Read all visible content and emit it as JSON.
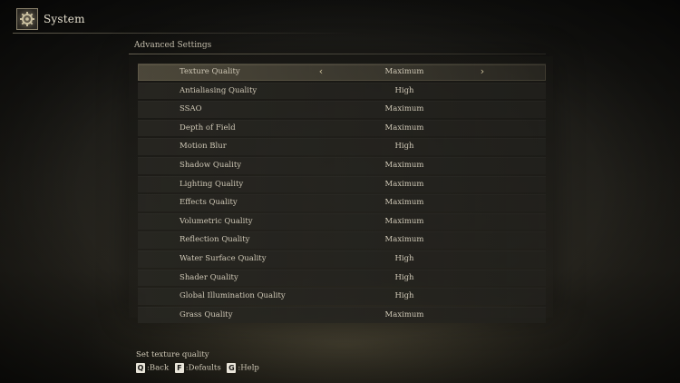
{
  "header": {
    "title": "System",
    "icon": "gear-icon"
  },
  "section": {
    "title": "Advanced Settings"
  },
  "settings": [
    {
      "label": "Texture Quality",
      "value": "Maximum",
      "selected": true
    },
    {
      "label": "Antialiasing Quality",
      "value": "High"
    },
    {
      "label": "SSAO",
      "value": "Maximum"
    },
    {
      "label": "Depth of Field",
      "value": "Maximum"
    },
    {
      "label": "Motion Blur",
      "value": "High"
    },
    {
      "label": "Shadow Quality",
      "value": "Maximum"
    },
    {
      "label": "Lighting Quality",
      "value": "Maximum"
    },
    {
      "label": "Effects Quality",
      "value": "Maximum"
    },
    {
      "label": "Volumetric Quality",
      "value": "Maximum"
    },
    {
      "label": "Reflection Quality",
      "value": "Maximum"
    },
    {
      "label": "Water Surface Quality",
      "value": "High"
    },
    {
      "label": "Shader Quality",
      "value": "High"
    },
    {
      "label": "Global Illumination Quality",
      "value": "High"
    },
    {
      "label": "Grass Quality",
      "value": "Maximum"
    }
  ],
  "selector": {
    "left_arrow": "‹",
    "right_arrow": "›"
  },
  "footer": {
    "description": "Set texture quality",
    "keys": [
      {
        "key": "Q",
        "label": ":Back"
      },
      {
        "key": "F",
        "label": ":Defaults"
      },
      {
        "key": "G",
        "label": ":Help"
      }
    ]
  },
  "colors": {
    "text": "#cfc8b6",
    "selected_row": "#786f5a",
    "arrow": "#c8bd98",
    "key_bg": "#e9e5da"
  }
}
